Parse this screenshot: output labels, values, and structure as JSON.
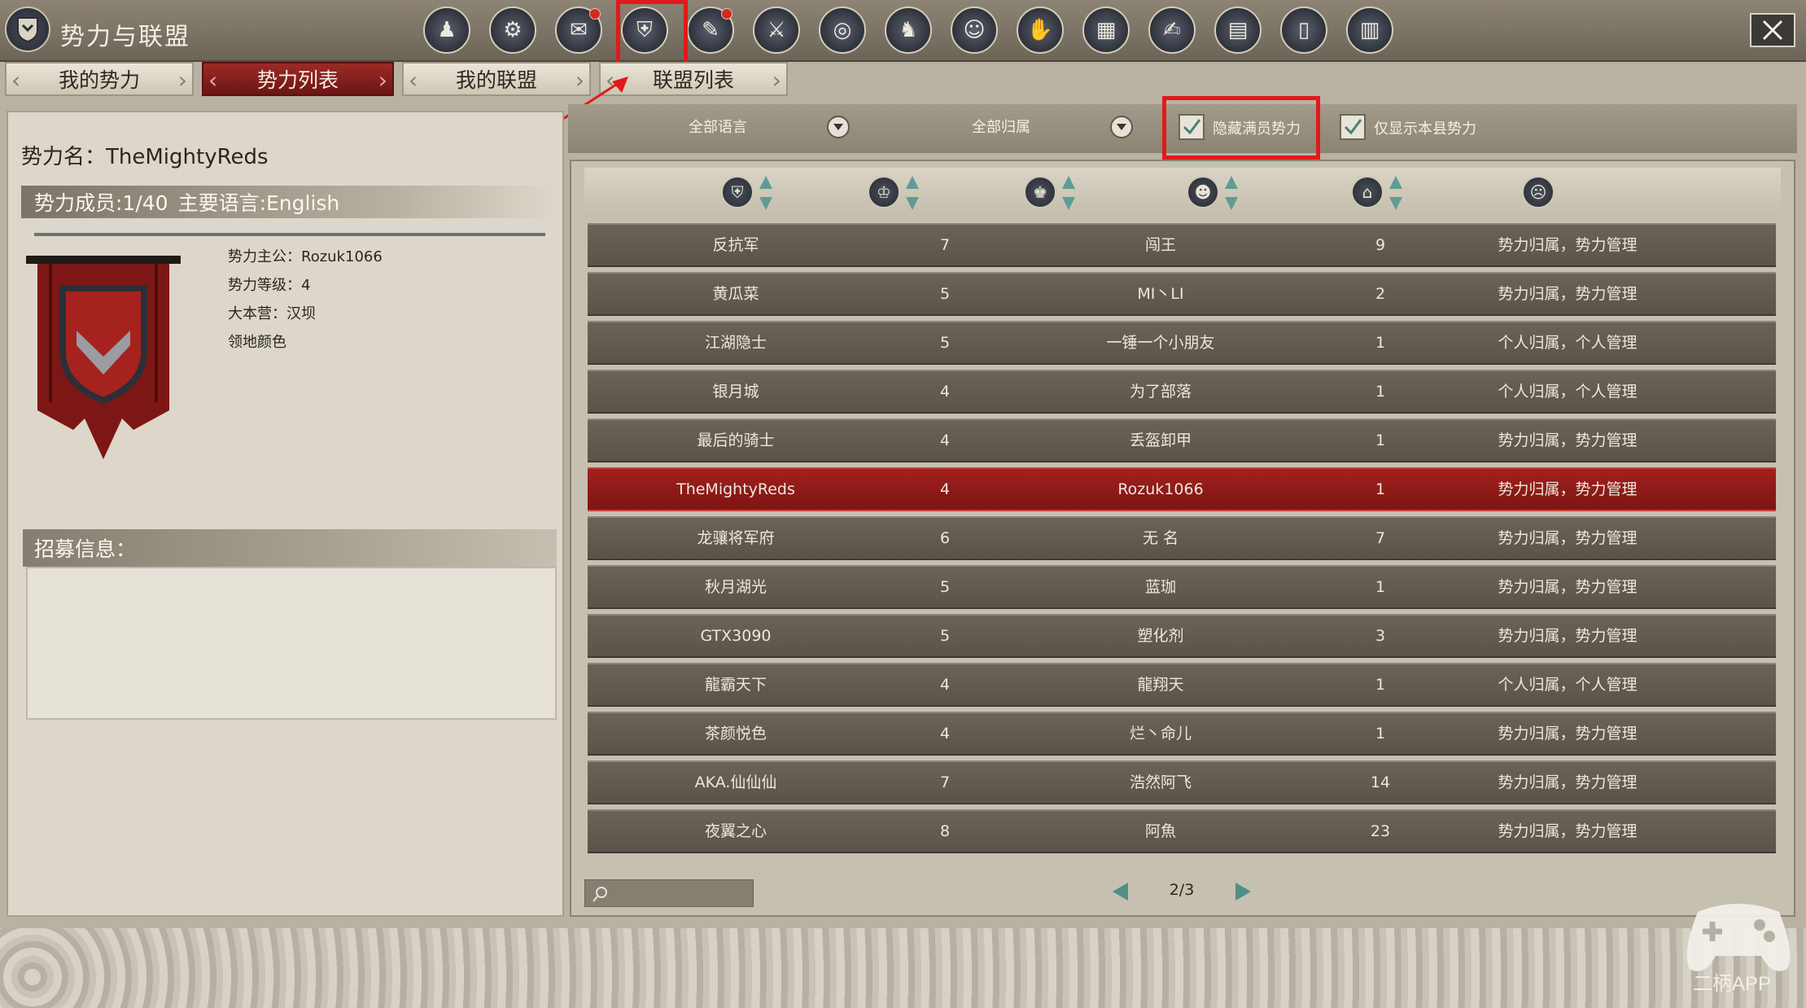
{
  "window": {
    "title": "势力与联盟",
    "close_icon": "close-icon"
  },
  "nav_icons": [
    {
      "name": "nav-character-icon",
      "badge": false
    },
    {
      "name": "nav-network-icon",
      "badge": false
    },
    {
      "name": "nav-bag-icon",
      "badge": true
    },
    {
      "name": "nav-faction-icon",
      "badge": false,
      "selected": true
    },
    {
      "name": "nav-scroll-icon",
      "badge": true
    },
    {
      "name": "nav-helmet-icon",
      "badge": false
    },
    {
      "name": "nav-target-icon",
      "badge": false
    },
    {
      "name": "nav-horse-icon",
      "badge": false
    },
    {
      "name": "nav-mask-icon",
      "badge": false
    },
    {
      "name": "nav-glove-icon",
      "badge": false
    },
    {
      "name": "nav-map-icon",
      "badge": false
    },
    {
      "name": "nav-quest-icon",
      "badge": false
    },
    {
      "name": "nav-book-icon",
      "badge": false
    },
    {
      "name": "nav-tablet-icon",
      "badge": false
    },
    {
      "name": "nav-ranking-icon",
      "badge": false
    }
  ],
  "tabs": [
    {
      "label": "我的势力",
      "active": false
    },
    {
      "label": "势力列表",
      "active": true
    },
    {
      "label": "我的联盟",
      "active": false
    },
    {
      "label": "联盟列表",
      "active": false
    }
  ],
  "faction": {
    "name_label": "势力名：TheMightyReds",
    "member_label": "势力成员:1/40",
    "language_label": "主要语言:English",
    "info": [
      "势力主公：Rozuk1066",
      "势力等级：4",
      "大本营：汉坝",
      "领地颜色"
    ],
    "banner_color": "#9c1f1c"
  },
  "recruit": {
    "title": "招募信息：",
    "text": ""
  },
  "filters": {
    "language": "全部语言",
    "ownership": "全部归属",
    "hide_full": {
      "label": "隐藏满员势力",
      "checked": true
    },
    "county_only": {
      "label": "仅显示本县势力",
      "checked": true
    }
  },
  "columns": [
    {
      "icon": "faction-shield-icon",
      "sortable": true
    },
    {
      "icon": "level-icon",
      "sortable": true
    },
    {
      "icon": "lord-icon",
      "sortable": true
    },
    {
      "icon": "members-icon",
      "sortable": true
    },
    {
      "icon": "management-icon",
      "sortable": true
    },
    {
      "icon": "apply-icon",
      "sortable": false
    }
  ],
  "rows": [
    {
      "name": "反抗军",
      "level": "7",
      "lord": "闯王",
      "members": "9",
      "mode": "势力归属，势力管理"
    },
    {
      "name": "黄瓜菜",
      "level": "5",
      "lord": "MI丶LI",
      "members": "2",
      "mode": "势力归属，势力管理"
    },
    {
      "name": "江湖隐士",
      "level": "5",
      "lord": "一锤一个小朋友",
      "members": "1",
      "mode": "个人归属，个人管理"
    },
    {
      "name": "银月城",
      "level": "4",
      "lord": "为了部落",
      "members": "1",
      "mode": "个人归属，个人管理"
    },
    {
      "name": "最后的骑士",
      "level": "4",
      "lord": "丢盔卸甲",
      "members": "1",
      "mode": "势力归属，势力管理"
    },
    {
      "name": "TheMightyReds",
      "level": "4",
      "lord": "Rozuk1066",
      "members": "1",
      "mode": "势力归属，势力管理",
      "selected": true
    },
    {
      "name": "龙骧将军府",
      "level": "6",
      "lord": "无 名",
      "members": "7",
      "mode": "势力归属，势力管理"
    },
    {
      "name": "秋月湖光",
      "level": "5",
      "lord": "蓝珈",
      "members": "1",
      "mode": "势力归属，势力管理"
    },
    {
      "name": "GTX3090",
      "level": "5",
      "lord": "塑化剂",
      "members": "3",
      "mode": "势力归属，势力管理"
    },
    {
      "name": "龍霸天下",
      "level": "4",
      "lord": "龍翔天",
      "members": "1",
      "mode": "个人归属，个人管理"
    },
    {
      "name": "茶颜悦色",
      "level": "4",
      "lord": "烂丶命儿",
      "members": "1",
      "mode": "势力归属，势力管理"
    },
    {
      "name": "AKA.仙仙仙",
      "level": "7",
      "lord": "浩然阿飞",
      "members": "14",
      "mode": "势力归属，势力管理"
    },
    {
      "name": "夜翼之心",
      "level": "8",
      "lord": "阿魚",
      "members": "23",
      "mode": "势力归属，势力管理"
    }
  ],
  "pagination": {
    "label": "2/3"
  },
  "search": {
    "placeholder": ""
  },
  "watermark": {
    "text": "二柄APP"
  },
  "colors": {
    "accent_red": "#9c1f1c",
    "highlight_box": "#e01a1a",
    "row_bg": "#5f584e"
  }
}
